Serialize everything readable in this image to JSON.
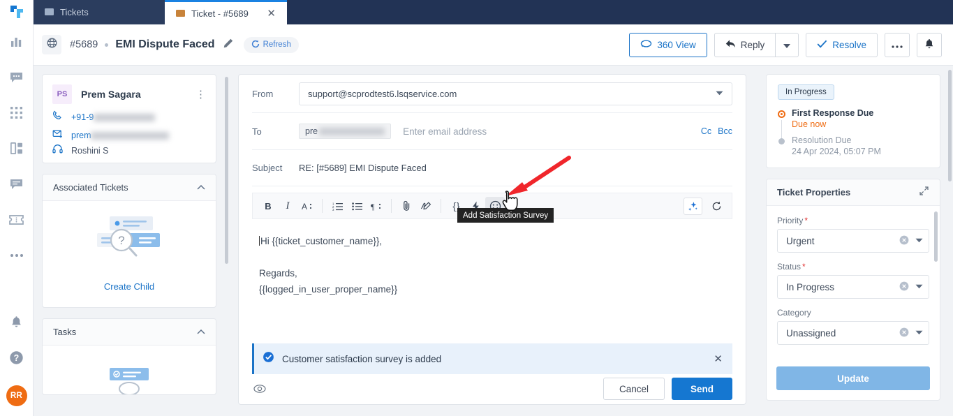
{
  "app": {
    "rail_icons": [
      "logo-icon",
      "analytics-icon",
      "chat-icon",
      "apps-grid-icon",
      "dashboard-icon",
      "message-icon",
      "ticket-icon",
      "more-icon",
      "bell-icon",
      "help-icon"
    ],
    "avatar_initials": "RR"
  },
  "tabs": [
    {
      "label": "Tickets",
      "active": false
    },
    {
      "label": "Ticket - #5689",
      "active": true
    }
  ],
  "header": {
    "ticket_number": "#5689",
    "title": "EMI Dispute Faced",
    "refresh_label": "Refresh",
    "buttons": {
      "view_360": "360 View",
      "reply": "Reply",
      "resolve": "Resolve",
      "more": "•••"
    }
  },
  "contact": {
    "initials": "PS",
    "name": "Prem Sagara",
    "phone_prefix": "+91-9",
    "email_prefix": "prem",
    "agent": "Roshini S"
  },
  "associated_tickets": {
    "title": "Associated Tickets",
    "create_child_label": "Create Child"
  },
  "tasks": {
    "title": "Tasks"
  },
  "compose": {
    "from_label": "From",
    "from_value": "support@scprodtest6.lsqservice.com",
    "to_label": "To",
    "to_chip_prefix": "pre",
    "to_placeholder": "Enter email address",
    "cc_label": "Cc",
    "bcc_label": "Bcc",
    "subject_label": "Subject",
    "subject_value": "RE: [#5689] EMI Dispute Faced",
    "body_lines": [
      "Hi {{ticket_customer_name}},",
      "",
      "Regards,",
      "{{logged_in_user_proper_name}}"
    ],
    "toolbar": [
      {
        "name": "bold-icon",
        "glyph": "B"
      },
      {
        "name": "italic-icon",
        "glyph": "I"
      },
      {
        "name": "font-style-icon",
        "glyph": "A:"
      },
      {
        "name": "ordered-list-icon",
        "glyph": ""
      },
      {
        "name": "bullet-list-icon",
        "glyph": ""
      },
      {
        "name": "paragraph-icon",
        "glyph": "¶:"
      },
      {
        "name": "attachment-icon",
        "glyph": ""
      },
      {
        "name": "signature-icon",
        "glyph": ""
      },
      {
        "name": "code-snippet-icon",
        "glyph": "{ }"
      },
      {
        "name": "quick-action-icon",
        "glyph": ""
      },
      {
        "name": "satisfaction-survey-icon",
        "glyph": ""
      }
    ],
    "tooltip": "Add Satisfaction Survey",
    "notification": "Customer satisfaction survey is added",
    "cancel_label": "Cancel",
    "send_label": "Send"
  },
  "sla": {
    "status_chip": "In Progress",
    "items": [
      {
        "title": "First Response Due",
        "value": "Due now",
        "state": "due"
      },
      {
        "title": "Resolution Due",
        "value": "24 Apr 2024, 05:07 PM",
        "state": "pending"
      }
    ]
  },
  "properties": {
    "title": "Ticket Properties",
    "fields": [
      {
        "label": "Priority",
        "required": true,
        "value": "Urgent"
      },
      {
        "label": "Status",
        "required": true,
        "value": "In Progress"
      },
      {
        "label": "Category",
        "required": false,
        "value": "Unassigned"
      }
    ],
    "update_label": "Update"
  },
  "colors": {
    "brand_blue": "#1577d1",
    "tab_navy": "#223355",
    "accent_orange": "#ef6c13",
    "notice_bg": "#e8f1fb"
  }
}
